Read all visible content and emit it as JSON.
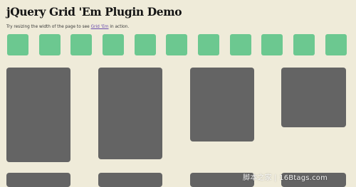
{
  "page": {
    "title": "jQuery Grid 'Em Plugin Demo",
    "intro_prefix": "Try resizing the width of the page to see ",
    "intro_link": "Grid 'Em",
    "intro_suffix": " in action."
  },
  "small_tiles": {
    "count": 11,
    "color": "#6cc890"
  },
  "large_panels": {
    "count": 8,
    "color": "#646464"
  },
  "colors": {
    "background": "#efebd9",
    "link": "#6a4bb0",
    "title": "#141414"
  },
  "watermark": {
    "text": "脚本之家 | 16Btags.com"
  }
}
